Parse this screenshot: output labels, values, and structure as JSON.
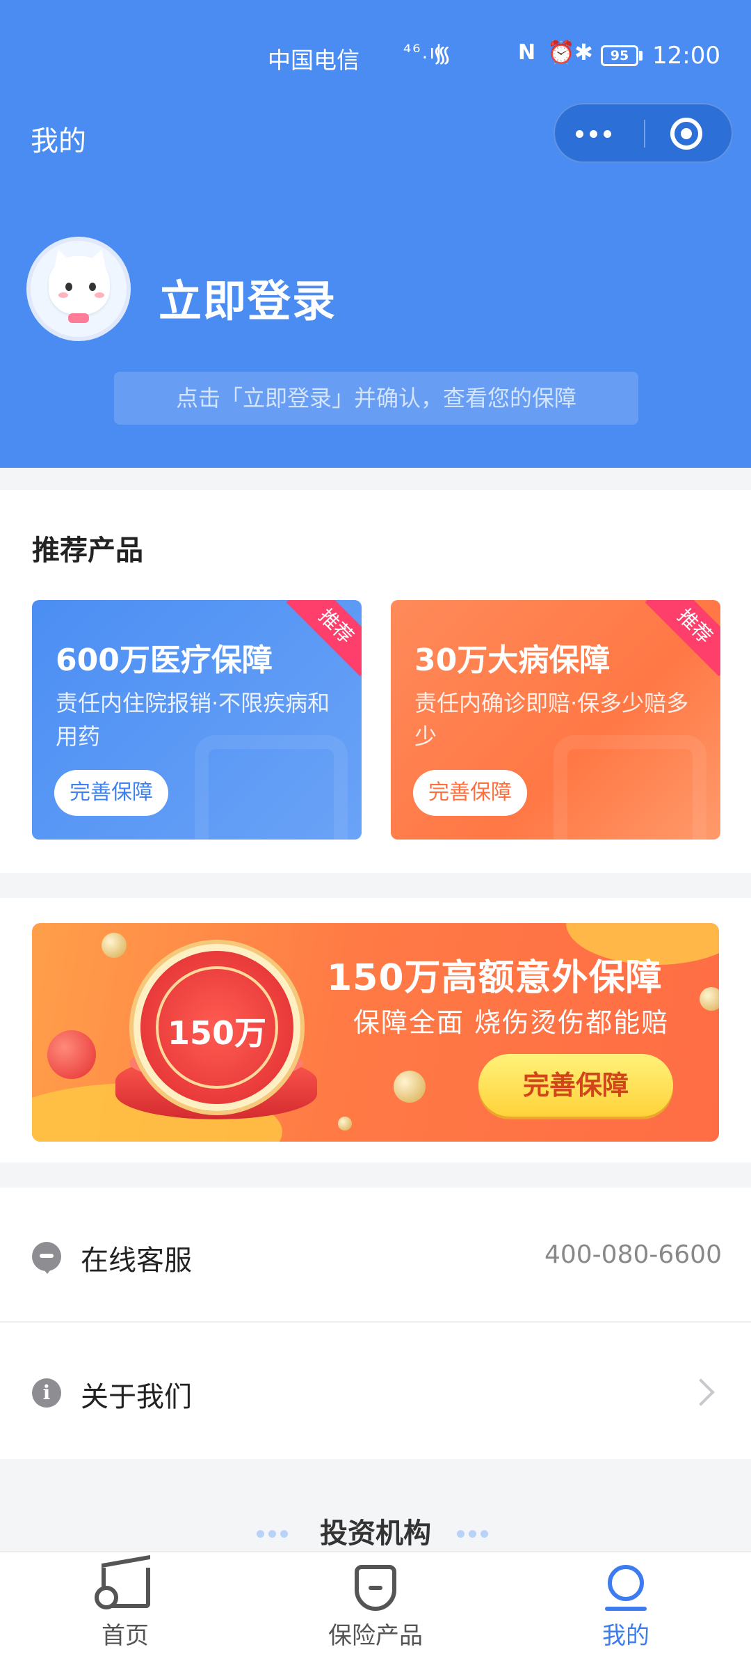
{
  "status_bar": {
    "carrier": "中国电信",
    "hd": "HD",
    "signal": "⁴⁶.ıl",
    "wifi": "᯾",
    "nfc": "N",
    "alarm": "⏰",
    "bluetooth": "✱",
    "battery": "95",
    "time": "12:00"
  },
  "header": {
    "title": "我的",
    "login_text": "立即登录",
    "login_hint": "点击「立即登录」并确认，查看您的保障"
  },
  "recommend": {
    "section_title": "推荐产品",
    "cards": [
      {
        "title": "600万医疗保障",
        "desc": "责任内住院报销·不限疾病和用药",
        "button": "完善保障",
        "ribbon": "推荐"
      },
      {
        "title": "30万大病保障",
        "desc": "责任内确诊即赔·保多少赔多少",
        "button": "完善保障",
        "ribbon": "推荐"
      }
    ]
  },
  "banner": {
    "coin_text": "150万",
    "title": "150万高额意外保障",
    "subtitle": "保障全面 烧伤烫伤都能赔",
    "button": "完善保障"
  },
  "list": {
    "service_label": "在线客服",
    "service_phone": "400-080-6600",
    "about_label": "关于我们"
  },
  "invest": {
    "title": "投资机构"
  },
  "tabbar": {
    "tabs": [
      {
        "label": "首页"
      },
      {
        "label": "保险产品"
      },
      {
        "label": "我的"
      }
    ],
    "active_color": "#3d7cf0"
  },
  "colors": {
    "header_blue": "#4a8cf2",
    "card_blue": "#4b8ef3",
    "card_orange": "#ff7845",
    "ribbon": "#ff3f6b"
  }
}
